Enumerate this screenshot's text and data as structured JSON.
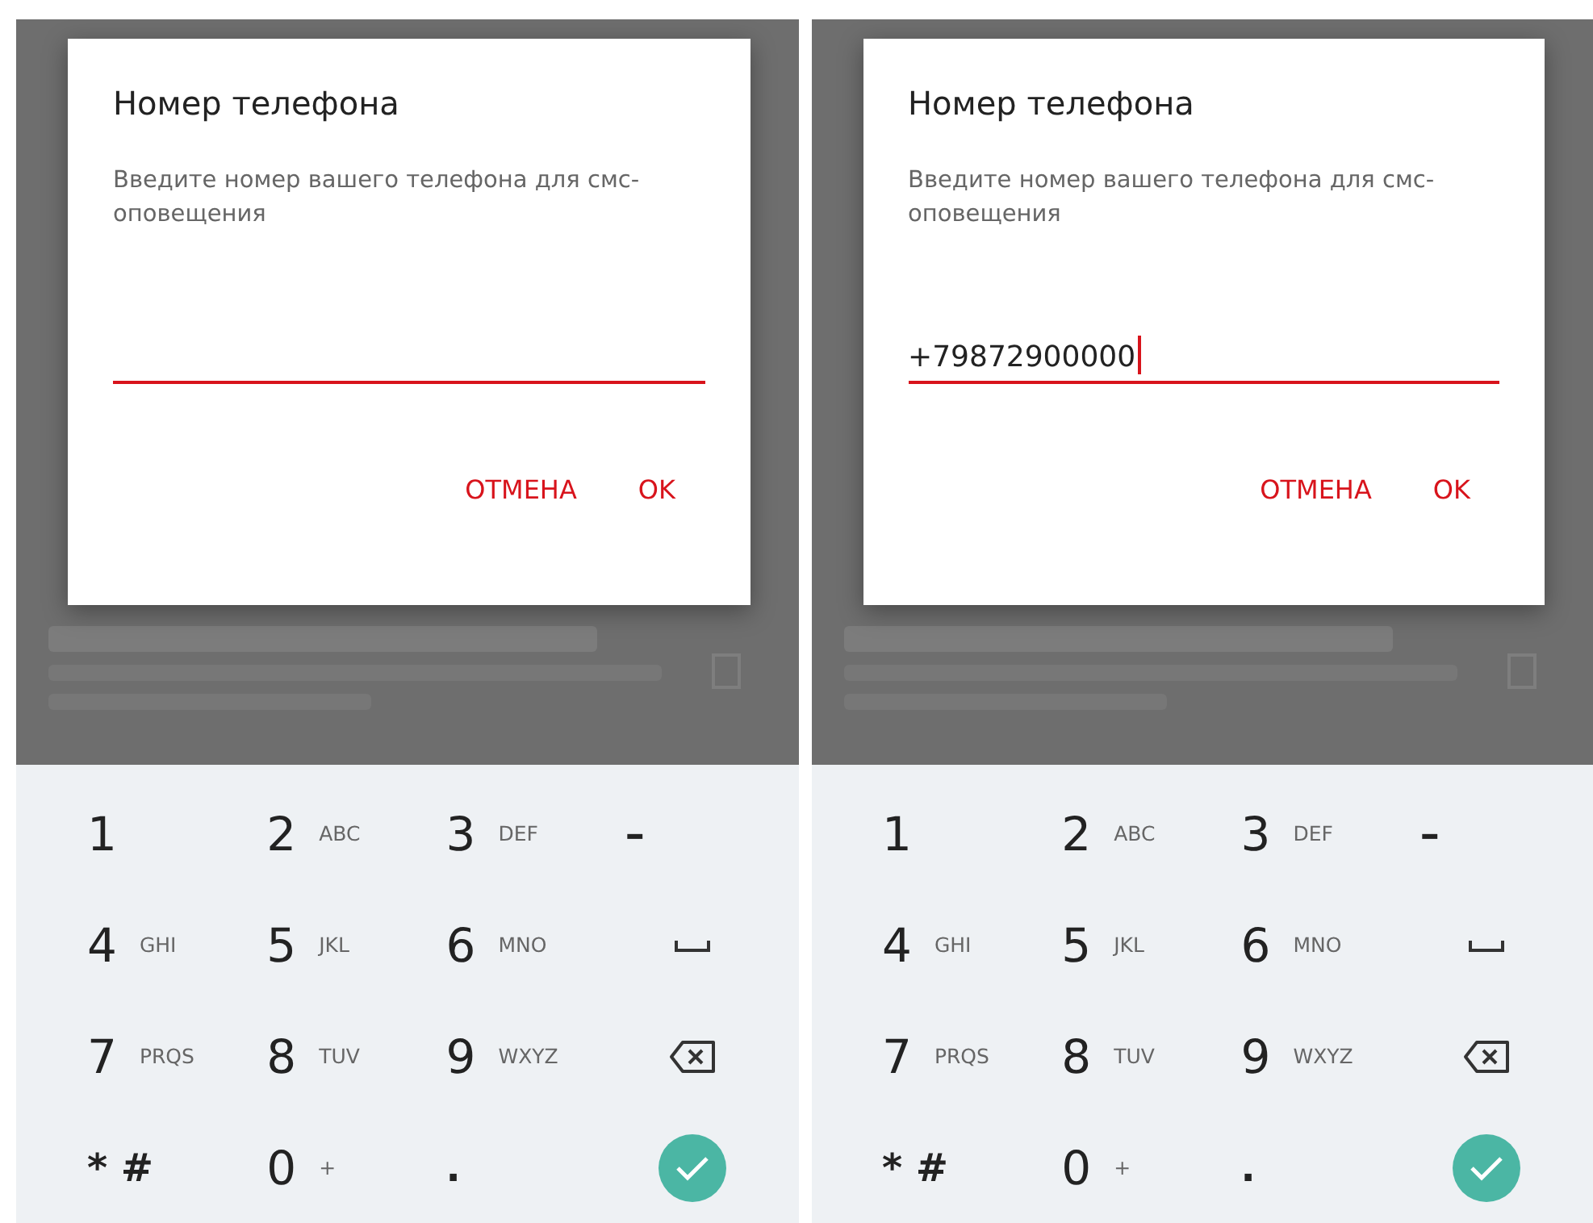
{
  "screens": [
    {
      "dialog": {
        "title": "Номер телефона",
        "message": "Введите номер вашего телефона для смс-оповещения",
        "input": {
          "cursor": false
        },
        "buttons": [
          "ОТМЕНА",
          "OK"
        ]
      },
      "keypad": {
        "keys": [
          {
            "kind": "digit",
            "main": "1"
          },
          {
            "kind": "digit",
            "main": "2",
            "sub": "ABC"
          },
          {
            "kind": "digit",
            "main": "3",
            "sub": "DEF"
          },
          {
            "kind": "symbol",
            "main": "–"
          },
          {
            "kind": "digit",
            "main": "4",
            "sub": "GHI"
          },
          {
            "kind": "digit",
            "main": "5",
            "sub": "JKL"
          },
          {
            "kind": "digit",
            "main": "6",
            "sub": "MNO"
          },
          {
            "kind": "space"
          },
          {
            "kind": "digit",
            "main": "7",
            "sub": "PRQS"
          },
          {
            "kind": "digit",
            "main": "8",
            "sub": "TUV"
          },
          {
            "kind": "digit",
            "main": "9",
            "sub": "WXYZ"
          },
          {
            "kind": "backspace"
          },
          {
            "kind": "symbol",
            "main": "* #"
          },
          {
            "kind": "digit",
            "main": "0",
            "sub": "+"
          },
          {
            "kind": "symbol",
            "main": "."
          },
          {
            "kind": "done"
          }
        ]
      }
    },
    {
      "dialog": {
        "title": "Номер телефона",
        "message": "Введите номер вашего телефона для смс-оповещения",
        "input": {
          "value": "+79872900000",
          "cursor": true
        },
        "buttons": [
          "ОТМЕНА",
          "OK"
        ]
      },
      "keypad": {
        "keys": [
          {
            "kind": "digit",
            "main": "1"
          },
          {
            "kind": "digit",
            "main": "2",
            "sub": "ABC"
          },
          {
            "kind": "digit",
            "main": "3",
            "sub": "DEF"
          },
          {
            "kind": "symbol",
            "main": "–"
          },
          {
            "kind": "digit",
            "main": "4",
            "sub": "GHI"
          },
          {
            "kind": "digit",
            "main": "5",
            "sub": "JKL"
          },
          {
            "kind": "digit",
            "main": "6",
            "sub": "MNO"
          },
          {
            "kind": "space"
          },
          {
            "kind": "digit",
            "main": "7",
            "sub": "PRQS"
          },
          {
            "kind": "digit",
            "main": "8",
            "sub": "TUV"
          },
          {
            "kind": "digit",
            "main": "9",
            "sub": "WXYZ"
          },
          {
            "kind": "backspace"
          },
          {
            "kind": "symbol",
            "main": "* #"
          },
          {
            "kind": "digit",
            "main": "0",
            "sub": "+"
          },
          {
            "kind": "symbol",
            "main": "."
          },
          {
            "kind": "done"
          }
        ]
      }
    }
  ]
}
